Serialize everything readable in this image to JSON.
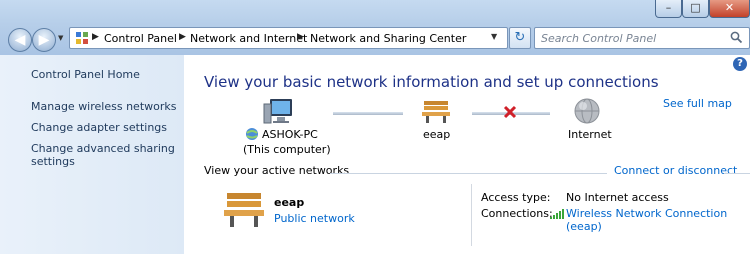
{
  "window": {
    "minimize_glyph": "–",
    "maximize_glyph": "□",
    "close_glyph": "✕"
  },
  "nav": {
    "back_glyph": "◀",
    "forward_glyph": "▶",
    "recent_glyph": "▼"
  },
  "address": {
    "breadcrumbs": [
      "Control Panel",
      "Network and Internet",
      "Network and Sharing Center"
    ],
    "separator": "▶",
    "dropdown_glyph": "▼",
    "refresh_glyph": "↻"
  },
  "search": {
    "placeholder": "Search Control Panel",
    "icon": "search-icon"
  },
  "sidebar": {
    "items": [
      {
        "label": "Control Panel Home"
      },
      {
        "label": "Manage wireless networks"
      },
      {
        "label": "Change adapter settings"
      },
      {
        "label": "Change advanced sharing"
      },
      {
        "label": "settings"
      }
    ]
  },
  "main": {
    "help_glyph": "?",
    "title": "View your basic network information and set up connections",
    "see_full_map": "See full map",
    "map": {
      "computer_name": "ASHOK-PC",
      "computer_sub": "(This computer)",
      "network_name": "eeap",
      "internet_label": "Internet"
    },
    "active_networks_title": "View your active networks",
    "connect_link": "Connect or disconnect",
    "active": {
      "name": "eeap",
      "type": "Public network",
      "access_type_key": "Access type:",
      "access_type_value": "No Internet access",
      "connections_key": "Connections:",
      "connections_value_1": "Wireless Network Connection",
      "connections_value_2": "(eeap)"
    }
  },
  "colors": {
    "link": "#0066cc",
    "title": "#1e3287",
    "error_x": "#d0202a",
    "signal": "#3aa63a"
  }
}
